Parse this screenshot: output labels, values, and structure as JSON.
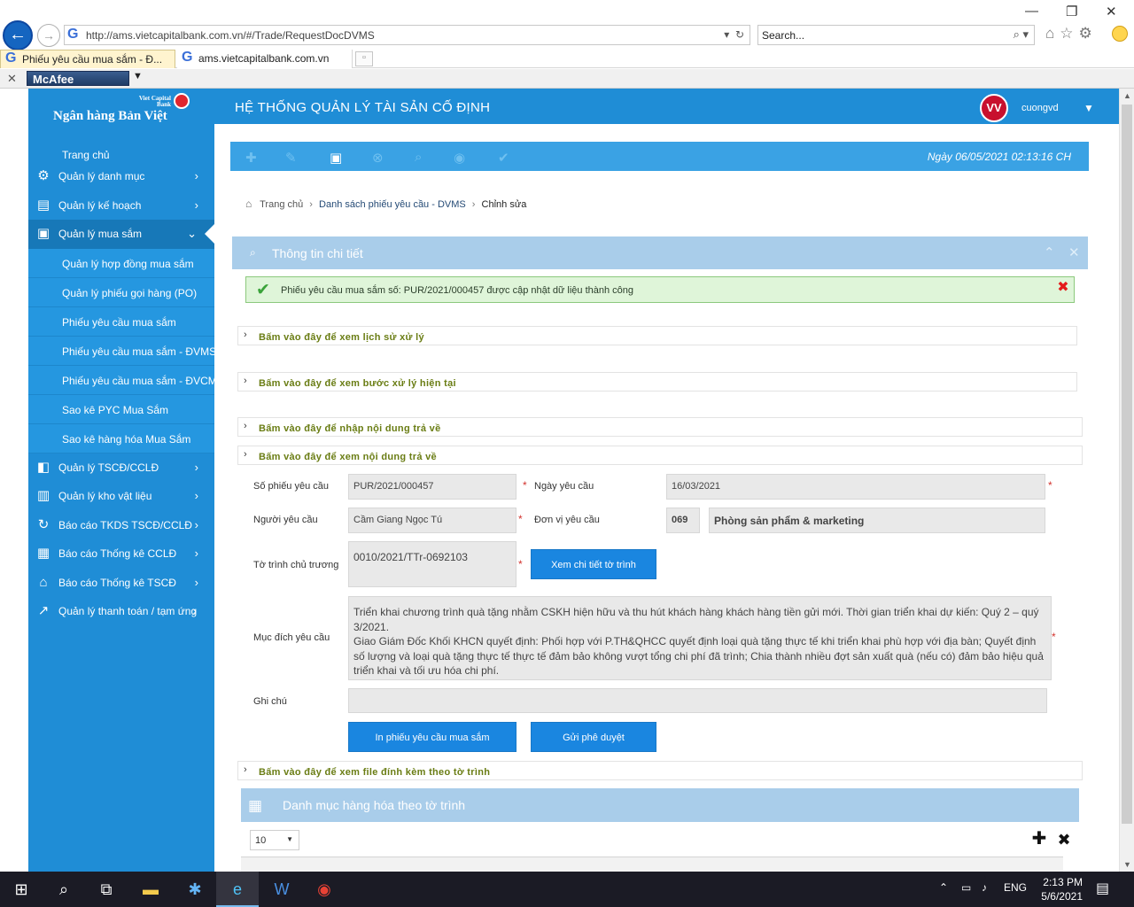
{
  "browser": {
    "url": "http://ams.vietcapitalbank.com.vn/#/Trade/RequestDocDVMS",
    "search_placeholder": "Search...",
    "tabs": [
      {
        "label": "Phiếu yêu cầu mua sắm - Đ...",
        "active": true
      },
      {
        "label": "ams.vietcapitalbank.com.vn",
        "active": false
      }
    ],
    "addon": "McAfee"
  },
  "brand": {
    "logo_small": "Viet Capital Bank",
    "logo_text": "Ngân hàng Bản Việt",
    "header_title": "HỆ THỐNG QUẢN LÝ TÀI SẢN CỐ ĐỊNH",
    "user_name": "cuongvd",
    "user_logo": "VV"
  },
  "sidebar": {
    "home": "Trang chủ",
    "items": [
      {
        "label": "Quản lý danh mục",
        "icon": "gear-icon"
      },
      {
        "label": "Quản lý kế hoạch",
        "icon": "monitor-icon"
      },
      {
        "label": "Quản lý mua sắm",
        "icon": "presentation-icon",
        "open": true
      },
      {
        "label": "Quản lý TSCĐ/CCLĐ",
        "icon": "bag-icon"
      },
      {
        "label": "Quản lý kho vật liệu",
        "icon": "briefcase-icon"
      },
      {
        "label": "Báo cáo TKDS TSCĐ/CCLĐ",
        "icon": "refresh-icon"
      },
      {
        "label": "Báo cáo Thống kê CCLĐ",
        "icon": "grid-icon"
      },
      {
        "label": "Báo cáo Thống kê TSCĐ",
        "icon": "building-icon"
      },
      {
        "label": "Quản lý thanh toán / tạm ứng",
        "icon": "chart-icon"
      }
    ],
    "sub_items": [
      "Quản lý hợp đồng mua sắm",
      "Quản lý phiếu gọi hàng (PO)",
      "Phiếu yêu cầu mua sắm",
      "Phiếu yêu cầu mua sắm - ĐVMS",
      "Phiếu yêu cầu mua sắm - ĐVCM",
      "Sao kê PYC Mua Sắm",
      "Sao kê hàng hóa Mua Sắm"
    ]
  },
  "toolbar": {
    "date_text": "Ngày 06/05/2021   02:13:16 CH"
  },
  "breadcrumb": {
    "home": "Trang chủ",
    "list": "Danh sách phiếu yêu cầu - DVMS",
    "current": "Chỉnh sửa"
  },
  "panel": {
    "title": "Thông tin chi tiết",
    "alert": "Phiếu yêu cầu mua sắm số: PUR/2021/000457 được cập nhật dữ liệu thành công"
  },
  "accordions": {
    "history": "Bấm vào đây để xem lịch sử xử lý",
    "current_step": "Bấm vào đây để xem bước xử lý hiện tại",
    "enter_return": "Bấm vào đây để nhập nội dung trả về",
    "view_return": "Bấm vào đây để xem nội dung trả về",
    "attachments": "Bấm vào đây để xem file đính kèm theo tờ trình"
  },
  "form": {
    "request_no_label": "Số phiếu yêu cầu",
    "request_no": "PUR/2021/000457",
    "request_date_label": "Ngày yêu cầu",
    "request_date": "16/03/2021",
    "requester_label": "Người yêu cầu",
    "requester": "Cầm Giang Ngọc Tú",
    "unit_label": "Đơn vị yêu cầu",
    "unit_code": "069",
    "unit_name": "Phòng sản phẩm & marketing",
    "proposal_label": "Tờ trình chủ trương",
    "proposal": "0010/2021/TTr-0692103",
    "view_proposal_button": "Xem chi tiết tờ trình",
    "purpose_label": "Mục đích yêu cầu",
    "purpose_line1": "Triển khai chương trình quà tặng nhằm CSKH hiện hữu và thu hút khách hàng khách hàng tiền gửi mới. Thời gian triển khai dự kiến: Quý 2 – quý 3/2021.",
    "purpose_line2": "Giao Giám Đốc Khối KHCN quyết định: Phối hợp với P.TH&QHCC quyết định loại quà tặng thực tế khi triển khai phù hợp với địa bàn; Quyết định số lượng và loại quà tặng thực tế thực tế đảm bảo không vượt tổng chi phí đã trình; Chia thành nhiều đợt sản xuất quà (nếu có) đảm bảo hiệu quả triển khai và tối ưu hóa chi phí.",
    "note_label": "Ghi chú",
    "note": "",
    "print_button": "In phiếu yêu cầu mua sắm",
    "approve_button": "Gửi phê duyệt"
  },
  "grid": {
    "title": "Danh mục hàng hóa theo tờ trình",
    "page_size": "10"
  },
  "taskbar": {
    "lang": "ENG",
    "time": "2:13 PM",
    "date": "5/6/2021"
  }
}
